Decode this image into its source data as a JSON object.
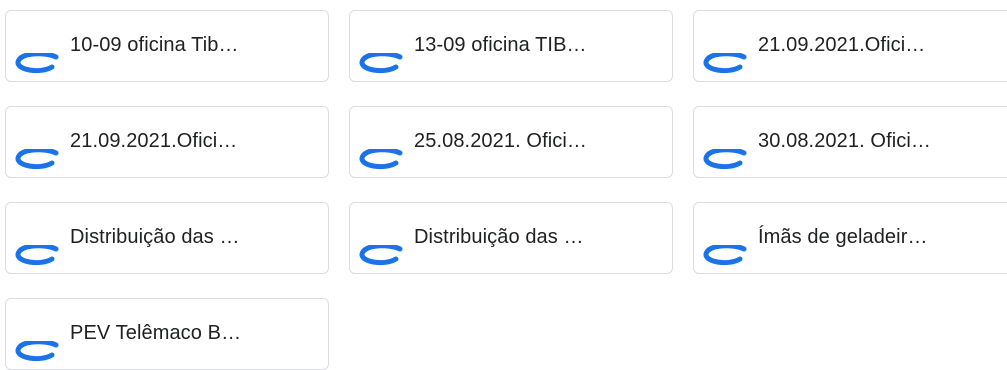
{
  "files": [
    {
      "name": "10-09 oficina Tib…",
      "icon": "file-arc-icon"
    },
    {
      "name": "13-09 oficina TIB…",
      "icon": "file-arc-icon"
    },
    {
      "name": "21.09.2021.Ofici…",
      "icon": "file-arc-icon"
    },
    {
      "name": "21.09.2021.Ofici…",
      "icon": "file-arc-icon"
    },
    {
      "name": "25.08.2021. Ofici…",
      "icon": "file-arc-icon"
    },
    {
      "name": "30.08.2021. Ofici…",
      "icon": "file-arc-icon"
    },
    {
      "name": "Distribuição das …",
      "icon": "file-arc-icon"
    },
    {
      "name": "Distribuição das …",
      "icon": "file-arc-icon"
    },
    {
      "name": "Ímãs de geladeir…",
      "icon": "file-arc-icon"
    },
    {
      "name": "PEV Telêmaco B…",
      "icon": "file-arc-icon"
    }
  ],
  "colors": {
    "icon": "#1a73e8",
    "text": "#202124",
    "border": "#dadce0"
  }
}
